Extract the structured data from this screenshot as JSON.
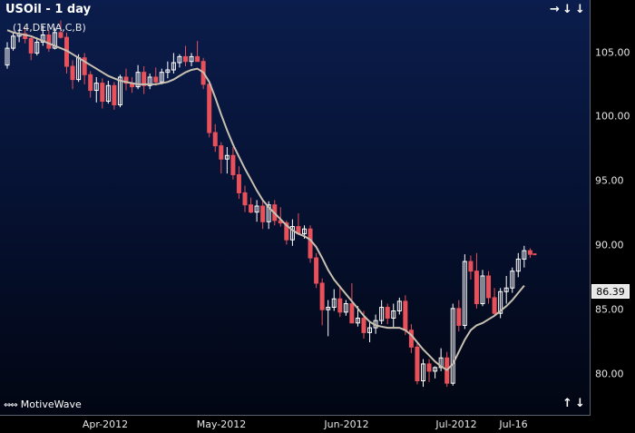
{
  "header": {
    "title": "USOil - 1 day",
    "subtitle": "(14,DEMA,C,B)"
  },
  "footer": {
    "brand": "MotiveWave",
    "brand_arrows": "⇔⇔"
  },
  "nav": {
    "right": "→",
    "down": "↓",
    "down2": "↓",
    "up_bottom": "↑",
    "down_bottom": "↓"
  },
  "last_price_label": "86.39",
  "colors": {
    "up": "#ffffff",
    "down": "#e8505a",
    "ma": "#c8c0b0",
    "bg_top": "#0b1d4c",
    "bg_bottom": "#020510"
  },
  "chart_data": {
    "type": "candlestick",
    "title": "USOil - 1 day",
    "indicator": "(14,DEMA,C,B)",
    "y_ticks": [
      "80.00",
      "85.00",
      "90.00",
      "95.00",
      "100.00",
      "105.00"
    ],
    "x_ticks": [
      "Apr-2012",
      "May-2012",
      "Jun-2012",
      "Jul-2012",
      "Jul-16"
    ],
    "ylim": [
      75.5,
      110.0
    ],
    "last_price": 86.39,
    "ohlc": [
      [
        104.6,
        106.5,
        104.3,
        106.0
      ],
      [
        106.0,
        107.4,
        105.8,
        107.0
      ],
      [
        107.0,
        107.6,
        106.5,
        107.2
      ],
      [
        107.2,
        107.8,
        106.4,
        106.8
      ],
      [
        106.8,
        107.0,
        105.0,
        105.6
      ],
      [
        105.6,
        106.9,
        105.4,
        106.5
      ],
      [
        106.5,
        107.9,
        106.2,
        107.1
      ],
      [
        107.1,
        107.5,
        105.7,
        106.0
      ],
      [
        106.0,
        107.7,
        105.9,
        107.3
      ],
      [
        107.3,
        108.3,
        106.8,
        106.9
      ],
      [
        106.9,
        107.3,
        103.9,
        104.5
      ],
      [
        104.5,
        105.0,
        102.6,
        103.4
      ],
      [
        103.4,
        105.5,
        103.2,
        105.2
      ],
      [
        105.2,
        105.6,
        103.0,
        103.8
      ],
      [
        103.8,
        104.1,
        101.9,
        102.5
      ],
      [
        102.5,
        103.6,
        101.5,
        103.1
      ],
      [
        103.1,
        103.5,
        101.0,
        101.6
      ],
      [
        101.6,
        103.3,
        101.4,
        102.9
      ],
      [
        102.9,
        103.2,
        100.9,
        101.3
      ],
      [
        101.3,
        103.8,
        101.1,
        103.6
      ],
      [
        103.6,
        104.3,
        102.5,
        103.1
      ],
      [
        103.1,
        103.6,
        102.3,
        102.8
      ],
      [
        102.8,
        104.6,
        102.6,
        104.0
      ],
      [
        104.0,
        104.5,
        102.2,
        102.9
      ],
      [
        102.9,
        103.9,
        102.6,
        103.6
      ],
      [
        103.6,
        104.4,
        102.9,
        103.2
      ],
      [
        103.2,
        104.3,
        103.0,
        104.0
      ],
      [
        104.0,
        104.9,
        103.5,
        104.2
      ],
      [
        104.2,
        105.6,
        103.9,
        104.8
      ],
      [
        104.8,
        105.5,
        104.4,
        105.3
      ],
      [
        105.3,
        106.2,
        104.5,
        104.9
      ],
      [
        104.9,
        105.6,
        104.5,
        105.3
      ],
      [
        105.3,
        106.6,
        104.9,
        104.9
      ],
      [
        104.9,
        105.2,
        102.6,
        103.0
      ],
      [
        103.0,
        103.3,
        98.6,
        99.0
      ],
      [
        99.0,
        99.7,
        97.4,
        97.9
      ],
      [
        97.9,
        98.2,
        95.6,
        96.8
      ],
      [
        96.8,
        97.8,
        95.6,
        97.1
      ],
      [
        97.1,
        97.8,
        95.1,
        95.5
      ],
      [
        95.5,
        96.2,
        93.5,
        94.0
      ],
      [
        94.0,
        94.6,
        92.4,
        93.0
      ],
      [
        93.0,
        93.6,
        92.3,
        92.4
      ],
      [
        92.4,
        93.4,
        91.6,
        92.9
      ],
      [
        92.9,
        93.4,
        91.0,
        91.6
      ],
      [
        91.6,
        93.3,
        91.0,
        93.0
      ],
      [
        93.0,
        93.4,
        91.3,
        91.7
      ],
      [
        91.7,
        92.8,
        91.2,
        91.5
      ],
      [
        91.5,
        91.7,
        89.7,
        90.1
      ],
      [
        90.1,
        91.8,
        89.6,
        91.2
      ],
      [
        91.2,
        92.3,
        90.5,
        90.6
      ],
      [
        90.6,
        91.3,
        90.2,
        91.0
      ],
      [
        91.0,
        91.3,
        88.2,
        88.6
      ],
      [
        88.6,
        89.0,
        86.1,
        86.5
      ],
      [
        86.5,
        86.9,
        83.0,
        84.3
      ],
      [
        84.3,
        85.1,
        82.1,
        84.5
      ],
      [
        84.5,
        86.0,
        84.2,
        85.2
      ],
      [
        85.2,
        86.3,
        83.7,
        84.1
      ],
      [
        84.1,
        85.1,
        83.8,
        84.8
      ],
      [
        84.8,
        86.5,
        84.4,
        83.2
      ],
      [
        83.2,
        84.6,
        82.9,
        83.6
      ],
      [
        83.6,
        84.2,
        81.9,
        82.4
      ],
      [
        82.4,
        83.3,
        81.6,
        82.8
      ],
      [
        82.8,
        83.9,
        82.3,
        83.4
      ],
      [
        83.4,
        85.1,
        83.1,
        84.5
      ],
      [
        84.5,
        84.8,
        83.1,
        83.6
      ],
      [
        83.6,
        84.8,
        82.8,
        84.2
      ],
      [
        84.2,
        85.3,
        83.9,
        85.0
      ],
      [
        85.0,
        85.5,
        82.2,
        82.6
      ],
      [
        82.6,
        83.1,
        80.7,
        81.2
      ],
      [
        81.2,
        81.5,
        78.1,
        78.4
      ],
      [
        78.4,
        80.2,
        77.9,
        79.8
      ],
      [
        79.8,
        80.2,
        78.3,
        79.2
      ],
      [
        79.2,
        79.6,
        78.6,
        79.5
      ],
      [
        79.5,
        81.1,
        79.2,
        80.3
      ],
      [
        80.3,
        80.8,
        77.9,
        78.2
      ],
      [
        78.2,
        84.8,
        78.0,
        84.4
      ],
      [
        84.4,
        85.1,
        82.5,
        83.0
      ],
      [
        83.0,
        88.9,
        82.7,
        88.3
      ],
      [
        88.3,
        88.8,
        86.8,
        87.5
      ],
      [
        87.5,
        89.0,
        84.4,
        84.8
      ],
      [
        84.8,
        87.6,
        84.6,
        87.1
      ],
      [
        87.1,
        87.5,
        84.8,
        85.3
      ],
      [
        85.3,
        86.1,
        83.8,
        84.0
      ],
      [
        84.0,
        86.1,
        83.6,
        85.8
      ],
      [
        85.8,
        87.1,
        84.8,
        86.1
      ],
      [
        86.1,
        87.8,
        85.7,
        87.5
      ],
      [
        87.5,
        89.0,
        87.0,
        88.5
      ],
      [
        88.5,
        89.6,
        87.8,
        89.2
      ],
      [
        89.2,
        89.4,
        88.6,
        88.9
      ]
    ],
    "ma_line": [
      107.5,
      107.3,
      107.2,
      107.1,
      107.0,
      106.8,
      106.6,
      106.4,
      106.2,
      106.0,
      105.8,
      105.5,
      105.2,
      104.9,
      104.6,
      104.3,
      104.0,
      103.7,
      103.5,
      103.3,
      103.2,
      103.1,
      103.0,
      103.0,
      103.0,
      103.0,
      103.1,
      103.2,
      103.4,
      103.7,
      104.0,
      104.2,
      104.3,
      104.0,
      103.2,
      101.9,
      100.5,
      99.2,
      98.0,
      97.0,
      96.0,
      95.1,
      94.2,
      93.4,
      92.8,
      92.3,
      91.8,
      91.3,
      90.9,
      90.6,
      90.4,
      90.1,
      89.5,
      88.6,
      87.6,
      86.8,
      86.2,
      85.6,
      85.0,
      84.4,
      83.8,
      83.3,
      83.0,
      82.9,
      82.8,
      82.8,
      82.8,
      82.6,
      82.2,
      81.6,
      81.0,
      80.5,
      80.0,
      79.6,
      79.3,
      79.8,
      80.8,
      81.8,
      82.6,
      83.0,
      83.2,
      83.5,
      83.8,
      84.2,
      84.6,
      85.1,
      85.7,
      86.3
    ]
  }
}
